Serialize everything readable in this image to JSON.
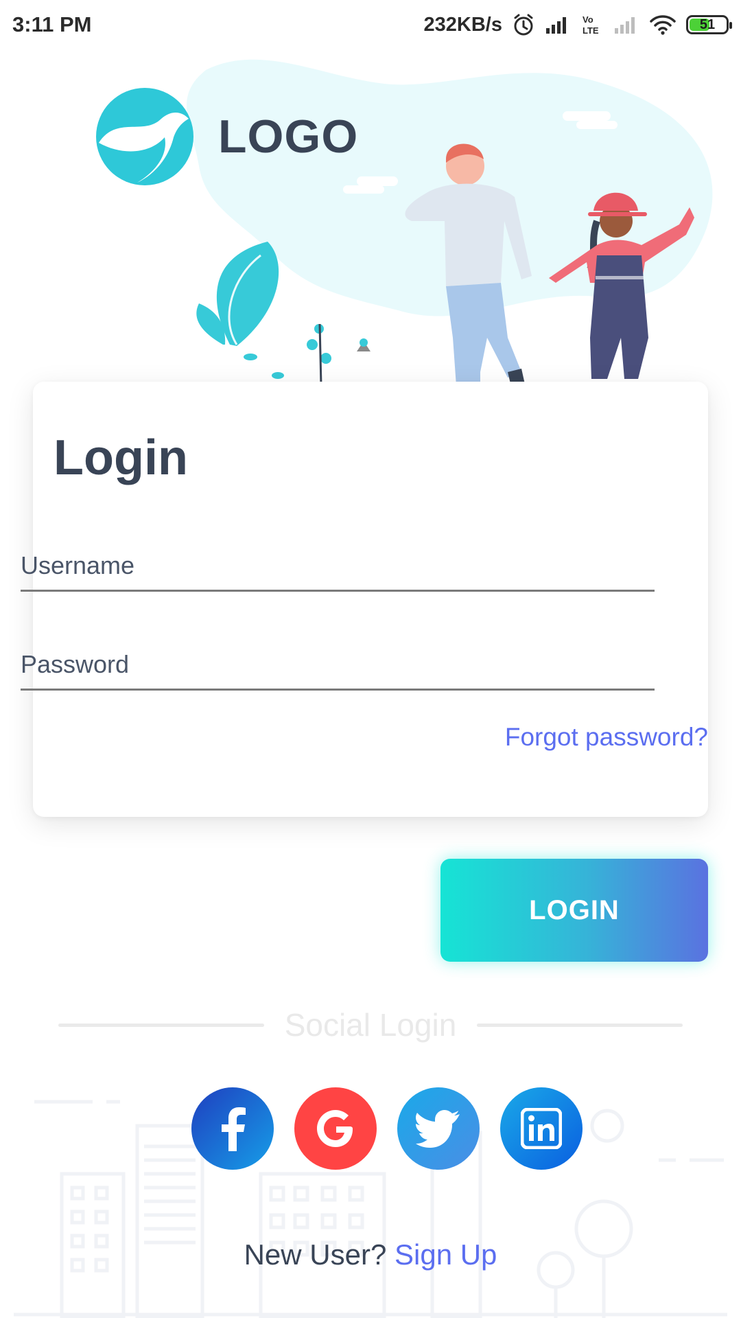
{
  "status_bar": {
    "time": "3:11 PM",
    "net_speed": "232KB/s",
    "volte": "Vo LTE",
    "battery": "51",
    "icons": [
      "alarm-icon",
      "signal-icon",
      "volte-icon",
      "signal-weak-icon",
      "wifi-icon",
      "battery-icon"
    ]
  },
  "brand": {
    "logo_text": "LOGO",
    "accent": "#2ec8d8"
  },
  "login": {
    "title": "Login",
    "username_placeholder": "Username",
    "password_placeholder": "Password",
    "forgot_label": "Forgot password?",
    "submit_label": "LOGIN"
  },
  "social": {
    "title": "Social Login",
    "providers": [
      {
        "name": "Facebook",
        "icon": "facebook-icon"
      },
      {
        "name": "Google",
        "icon": "google-icon"
      },
      {
        "name": "Twitter",
        "icon": "twitter-icon"
      },
      {
        "name": "LinkedIn",
        "icon": "linkedin-icon"
      }
    ]
  },
  "footer": {
    "prompt": "New User?",
    "signup_label": "Sign Up"
  },
  "colors": {
    "heading": "#394456",
    "link": "#5b6ef0",
    "gradient_start": "#16e4d5",
    "gradient_end": "#5a72e0"
  }
}
